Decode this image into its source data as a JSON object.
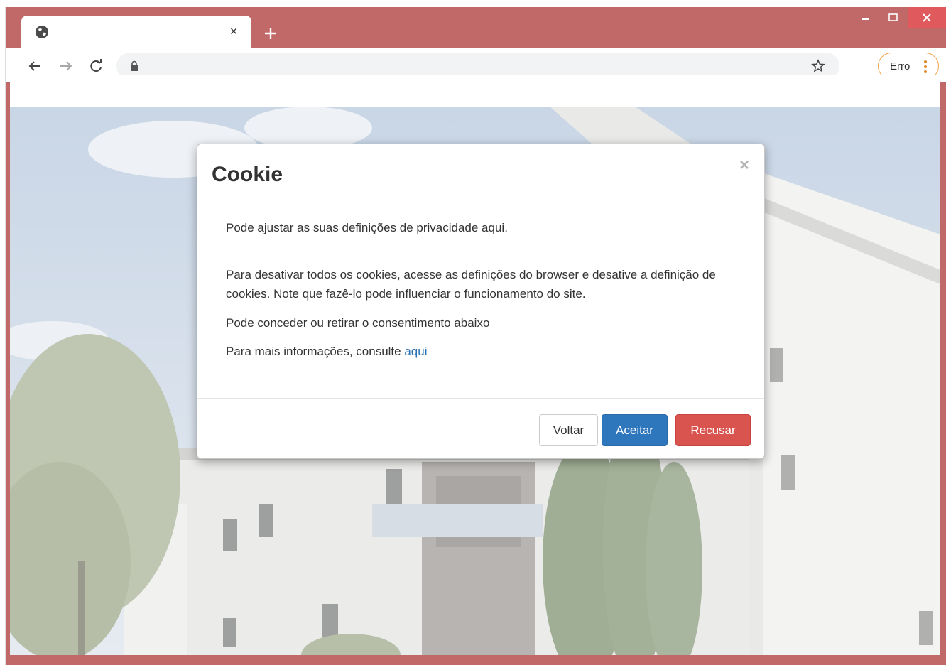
{
  "browser": {
    "tab_close_glyph": "×",
    "new_tab_glyph": "+",
    "status_chip": "Erro",
    "colors": {
      "frame": "#c16868",
      "close_button": "#e0595c",
      "chip_border": "#f0a24a"
    }
  },
  "icons": {
    "tab": "globe-icon",
    "back": "arrow-left-icon",
    "forward": "arrow-right-icon",
    "reload": "reload-icon",
    "lock": "lock-icon",
    "bookmark": "star-icon",
    "menu": "three-dots-icon",
    "window_minimize": "minimize-icon",
    "window_maximize": "maximize-icon",
    "window_close": "close-icon"
  },
  "modal": {
    "title": "Cookie",
    "close_glyph": "×",
    "paragraph_1": "Pode ajustar as suas definições de privacidade aqui.",
    "paragraph_2": "Para desativar todos os cookies, acesse as definições do browser e desative a definição de cookies. Note que fazê-lo pode influenciar o funcionamento do site.",
    "paragraph_3": "Pode conceder ou retirar o consentimento abaixo",
    "paragraph_4_prefix": "Para mais informações, consulte ",
    "paragraph_4_link": "aqui",
    "buttons": {
      "back": "Voltar",
      "accept": "Aceitar",
      "refuse": "Recusar"
    },
    "colors": {
      "accept": "#2f77bd",
      "refuse": "#d9534f",
      "link": "#2a6fb0"
    }
  }
}
